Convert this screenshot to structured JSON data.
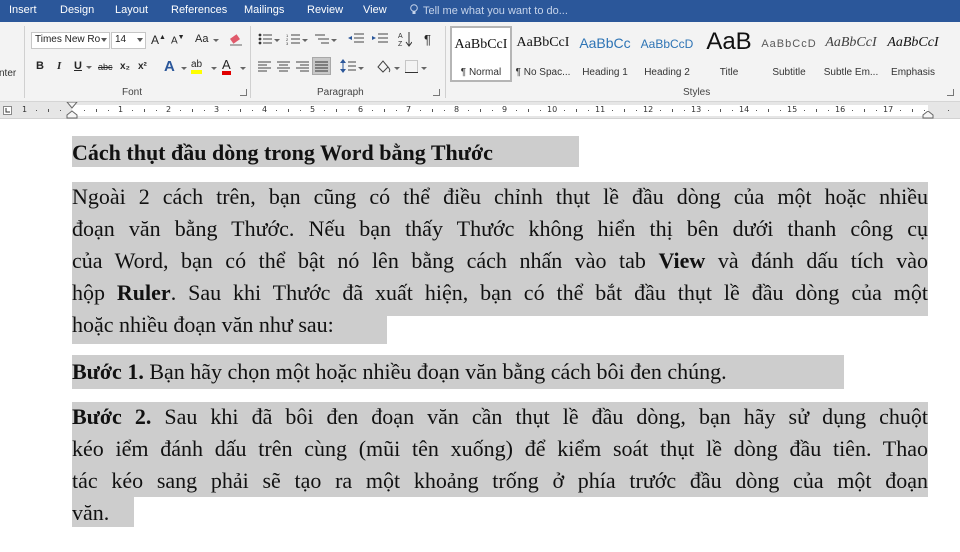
{
  "tabs": [
    "Insert",
    "Design",
    "Layout",
    "References",
    "Mailings",
    "Review",
    "View"
  ],
  "tell_me": "Tell me what you want to do...",
  "clipboard_partial_label": "nter",
  "font": {
    "name": "Times New Ro",
    "size": "14",
    "grow": "A",
    "shrink": "A",
    "case": "Aa",
    "bold": "B",
    "italic": "I",
    "underline": "U",
    "strike": "abc",
    "subscript": "x₂",
    "superscript": "x²",
    "effects": "A",
    "highlight": "ab",
    "color": "A",
    "group_label": "Font"
  },
  "paragraph": {
    "group_label": "Paragraph"
  },
  "styles": {
    "group_label": "Styles",
    "items": [
      {
        "preview": "AaBbCcI",
        "name": "¶ Normal"
      },
      {
        "preview": "AaBbCcI",
        "name": "¶ No Spac..."
      },
      {
        "preview": "AaBbCc",
        "name": "Heading 1"
      },
      {
        "preview": "AaBbCcD",
        "name": "Heading 2"
      },
      {
        "preview": "AaB",
        "name": "Title"
      },
      {
        "preview": "AaBbCcD",
        "name": "Subtitle"
      },
      {
        "preview": "AaBbCcI",
        "name": "Subtle Em..."
      },
      {
        "preview": "AaBbCcI",
        "name": "Emphasis"
      }
    ]
  },
  "ruler": {
    "numbers": [
      "1",
      "1",
      "2",
      "3",
      "4",
      "5",
      "6",
      "7",
      "8",
      "9",
      "10",
      "11",
      "12",
      "13",
      "14",
      "15",
      "16",
      "17"
    ]
  },
  "document": {
    "heading": "Cách thụt đầu dòng trong Word bằng Thước",
    "p1": [
      "Ngoài 2 cách trên, bạn cũng có thể điều chỉnh thụt lề đầu dòng của một hoặc nhiều",
      "đoạn văn bằng Thước. Nếu bạn thấy Thước không hiển thị bên dưới thanh công cụ"
    ],
    "p1_l3_pre": "của Word, bạn có thể bật nó lên bằng cách nhấn vào tab",
    "p1_l3_bold": "View",
    "p1_l3_post": "và đánh dấu tích vào",
    "p1_l4_pre": "hộp",
    "p1_l4_bold": "Ruler",
    "p1_l4_post": ". Sau khi Thước đã xuất hiện, bạn có thể bắt đầu thụt lề đầu dòng của một",
    "p1_l5": "hoặc nhiều đoạn văn như sau:",
    "step1_bold": "Bước 1.",
    "step1_text": " Bạn hãy chọn một hoặc nhiều đoạn văn bằng cách bôi đen chúng.",
    "step2_bold": "Bước 2.",
    "step2_l1": " Sau khi đã bôi đen đoạn văn cần thụt lề đầu dòng, bạn hãy sử dụng chuột",
    "step2_lines": [
      "kéo iểm đánh dấu trên cùng (mũi tên xuống) để kiểm soát thụt lề dòng đầu tiên. Thao",
      "tác kéo sang phải sẽ tạo ra một khoảng trống ở phía trước đầu dòng của một đoạn",
      "văn."
    ]
  }
}
